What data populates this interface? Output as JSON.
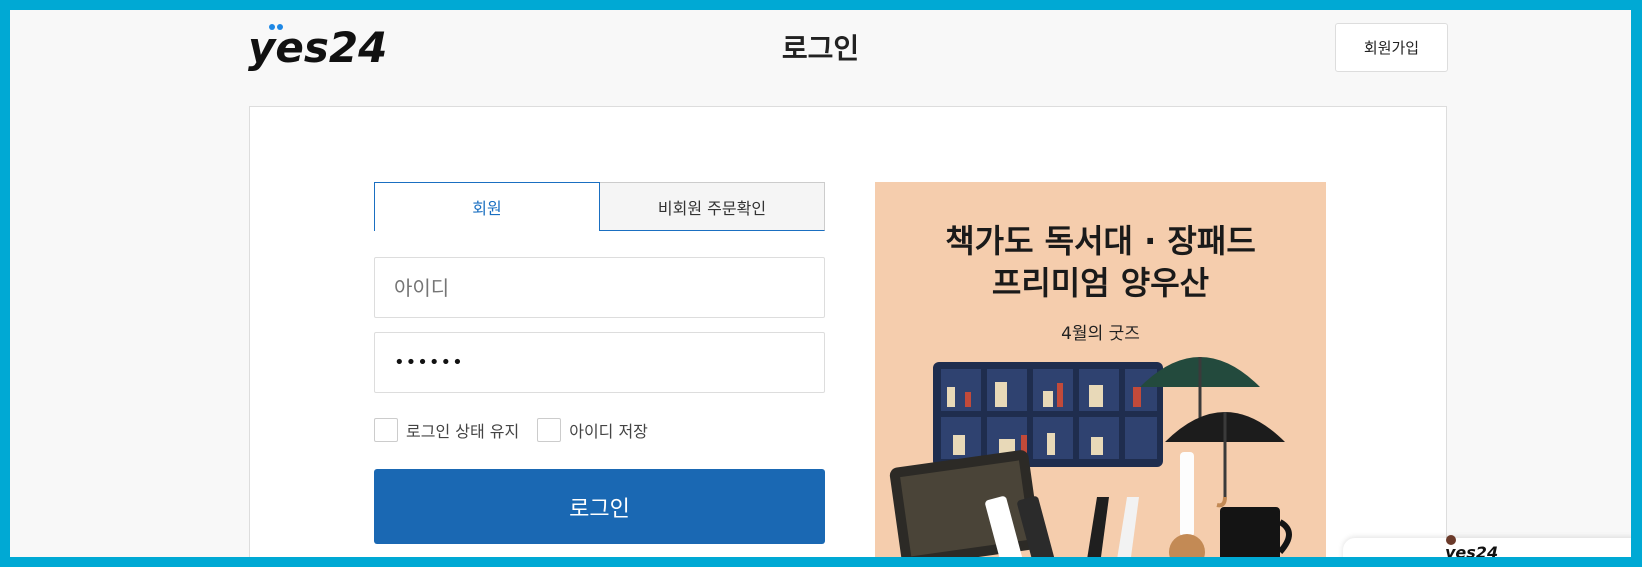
{
  "header": {
    "logo_text": "yes24",
    "title": "로그인",
    "signup_label": "회원가입"
  },
  "login": {
    "tabs": [
      {
        "label": "회원",
        "active": true
      },
      {
        "label": "비회원 주문확인",
        "active": false
      }
    ],
    "id_placeholder": "아이디",
    "password_value": "••••••",
    "keep_login_label": "로그인 상태 유지",
    "save_id_label": "아이디 저장",
    "submit_label": "로그인"
  },
  "banner": {
    "title_line1": "책가도 독서대 · 장패드",
    "title_line2": "프리미엄 양우산",
    "subtitle": "4월의 굿즈"
  },
  "floating_widget": {
    "logo_text": "yes24"
  },
  "colors": {
    "frame": "#00a9d4",
    "accent": "#1a68b3",
    "banner_bg": "#f5cdad"
  }
}
